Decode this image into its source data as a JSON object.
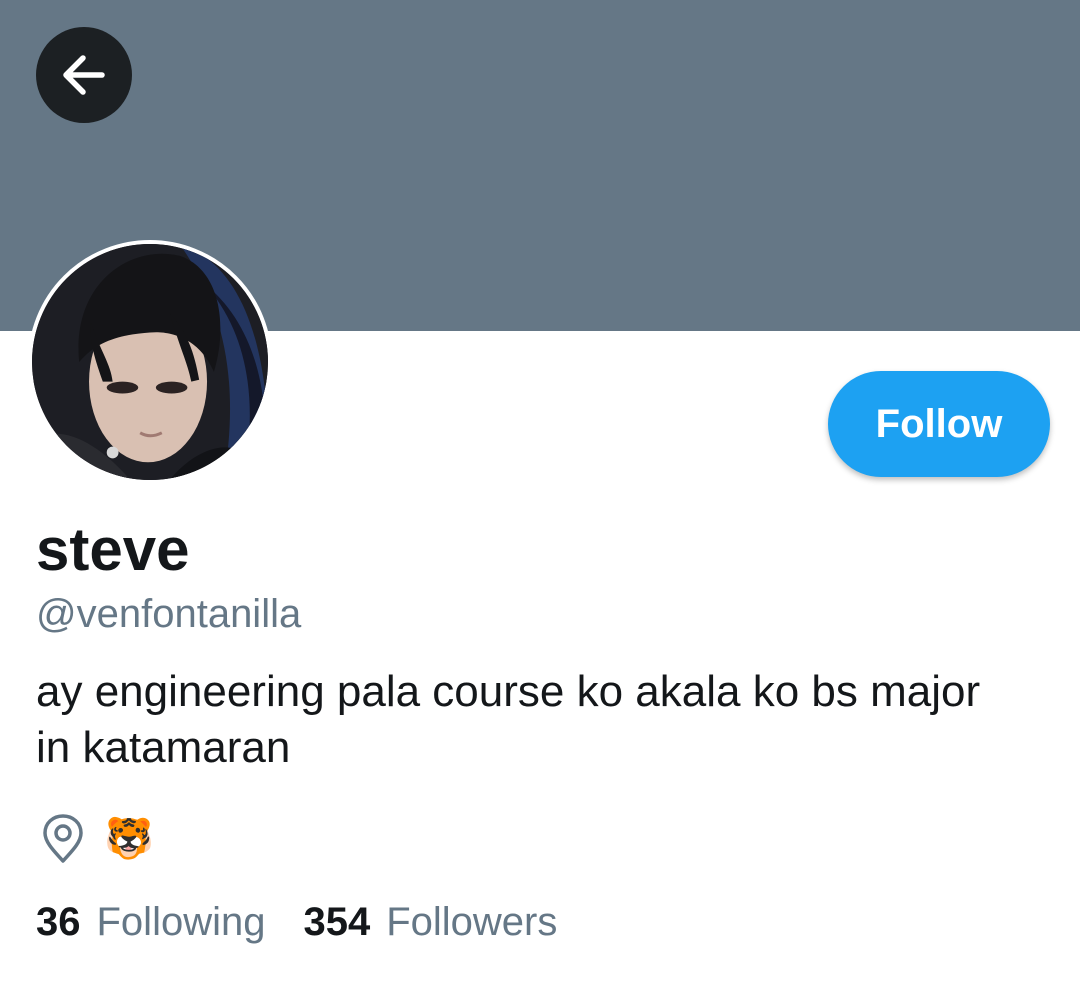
{
  "colors": {
    "banner": "#657786",
    "accent": "#1da1f2",
    "secondary_text": "#657786",
    "primary_text": "#14171a",
    "back_button_bg": "#1c2023"
  },
  "header": {
    "back_icon": "arrow-left-icon"
  },
  "profile": {
    "display_name": "steve",
    "handle": "@venfontanilla",
    "bio": "ay engineering pala course ko akala ko bs major in katamaran",
    "location_icon": "location-pin-icon",
    "location": "🐯",
    "avatar": "avatar-photo"
  },
  "actions": {
    "follow_label": "Follow"
  },
  "stats": {
    "following_count": "36",
    "following_label": "Following",
    "followers_count": "354",
    "followers_label": "Followers"
  }
}
